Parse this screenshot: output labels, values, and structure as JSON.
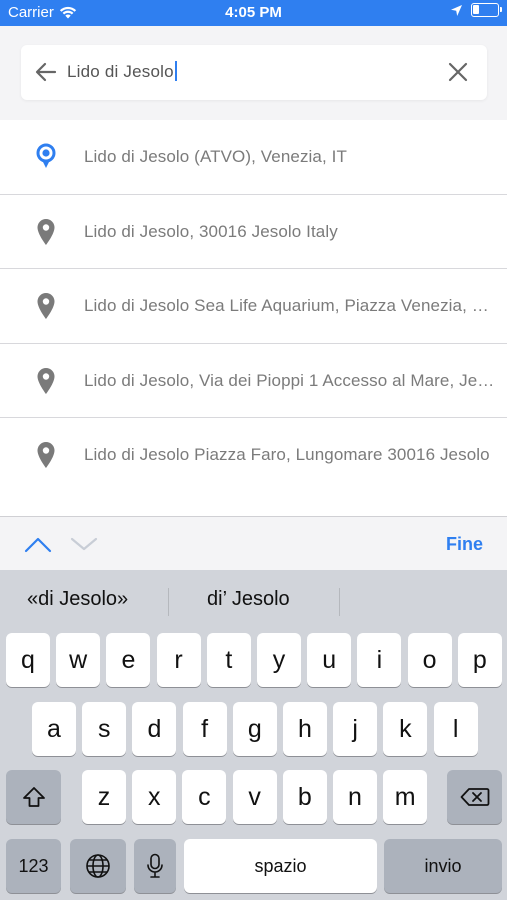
{
  "status_bar": {
    "carrier": "Carrier",
    "time": "4:05 PM",
    "battery_level": 0.25
  },
  "search": {
    "value": "Lido di Jesolo"
  },
  "results": [
    {
      "label": "Lido di Jesolo (ATVO), Venezia, IT",
      "icon": "location-pin-icon",
      "color": "#2f7ff0"
    },
    {
      "label": "Lido di Jesolo, 30016 Jesolo Italy",
      "icon": "map-pin-icon",
      "color": "#7a7a7a"
    },
    {
      "label": "Lido di Jesolo Sea Life Aquarium, Piazza Venezia, Jesolo",
      "icon": "map-pin-icon",
      "color": "#7a7a7a"
    },
    {
      "label": "Lido di Jesolo, Via dei Pioppi 1 Accesso al Mare, Jesolo",
      "icon": "map-pin-icon",
      "color": "#7a7a7a"
    },
    {
      "label": "Lido di Jesolo Piazza Faro, Lungomare 30016 Jesolo",
      "icon": "map-pin-icon",
      "color": "#7a7a7a"
    }
  ],
  "accessory": {
    "done_label": "Fine"
  },
  "keyboard": {
    "suggestions": [
      "«di Jesolo»",
      "di’ Jesolo"
    ],
    "row1": [
      "q",
      "w",
      "e",
      "r",
      "t",
      "y",
      "u",
      "i",
      "o",
      "p"
    ],
    "row2": [
      "a",
      "s",
      "d",
      "f",
      "g",
      "h",
      "j",
      "k",
      "l"
    ],
    "row3": [
      "z",
      "x",
      "c",
      "v",
      "b",
      "n",
      "m"
    ],
    "numbers_key": "123",
    "space_key": "spazio",
    "return_key": "invio"
  },
  "colors": {
    "accent": "#2f7ff0",
    "pin_gray": "#7a7a7a"
  }
}
